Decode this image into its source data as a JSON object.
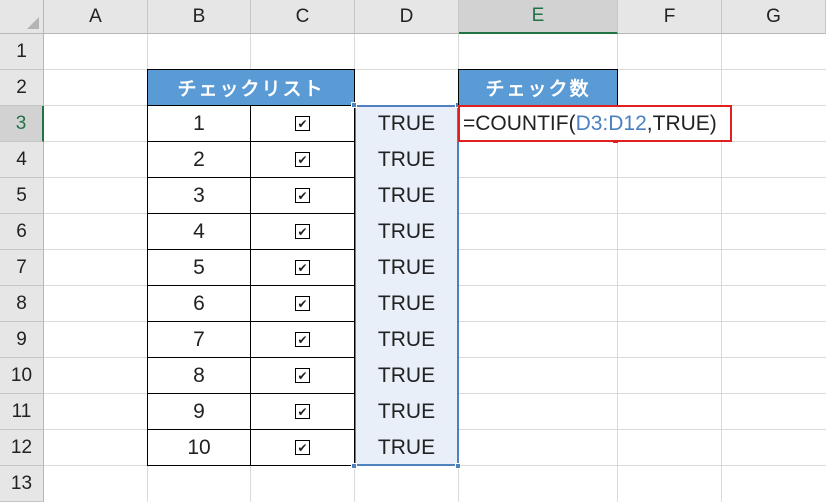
{
  "columns": [
    "A",
    "B",
    "C",
    "D",
    "E",
    "F",
    "G"
  ],
  "rows": [
    "1",
    "2",
    "3",
    "4",
    "5",
    "6",
    "7",
    "8",
    "9",
    "10",
    "11",
    "12",
    "13"
  ],
  "active_column": "E",
  "active_row": "3",
  "checklist": {
    "header": "チェックリスト",
    "numbers": [
      "1",
      "2",
      "3",
      "4",
      "5",
      "6",
      "7",
      "8",
      "9",
      "10"
    ],
    "checked": [
      true,
      true,
      true,
      true,
      true,
      true,
      true,
      true,
      true,
      true
    ],
    "check_glyph": "✔",
    "values": [
      "TRUE",
      "TRUE",
      "TRUE",
      "TRUE",
      "TRUE",
      "TRUE",
      "TRUE",
      "TRUE",
      "TRUE",
      "TRUE"
    ]
  },
  "count": {
    "header": "チェック数",
    "formula_prefix": "=COUNTIF(",
    "formula_range": "D3:D12",
    "formula_suffix": ",TRUE)"
  },
  "colors": {
    "header_fill": "#5b9bd5",
    "selection": "#4f81bd",
    "selection_fill": "#e8eff8",
    "formula_border": "#e02020",
    "range_ref": "#4a7fc1",
    "active_header": "#217346"
  }
}
